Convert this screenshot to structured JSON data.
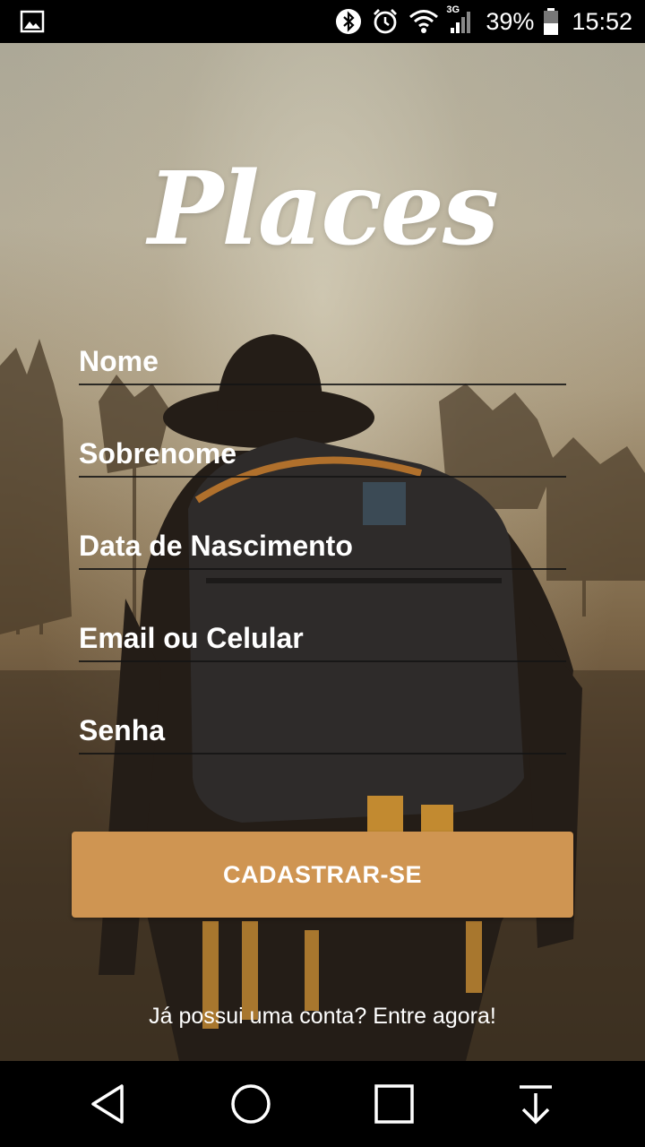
{
  "status_bar": {
    "icons": [
      "image-icon",
      "bluetooth-icon",
      "alarm-icon",
      "wifi-icon",
      "signal-3g-icon",
      "battery-icon"
    ],
    "network_type": "3G",
    "battery_percent": "39%",
    "time": "15:52"
  },
  "app": {
    "logo_text": "Places"
  },
  "form": {
    "first_name_placeholder": "Nome",
    "last_name_placeholder": "Sobrenome",
    "birthdate_placeholder": "Data de Nascimento",
    "email_phone_placeholder": "Email ou Celular",
    "password_placeholder": "Senha",
    "submit_label": "CADASTRAR-SE",
    "login_prompt": "Já possui uma conta? Entre agora!"
  },
  "colors": {
    "accent": "#cf9552",
    "status_bar": "#000000",
    "nav_bar": "#000000",
    "text": "#ffffff"
  },
  "nav_bar": {
    "icons": [
      "back-icon",
      "home-icon",
      "recents-icon",
      "notifications-pull-icon"
    ]
  }
}
